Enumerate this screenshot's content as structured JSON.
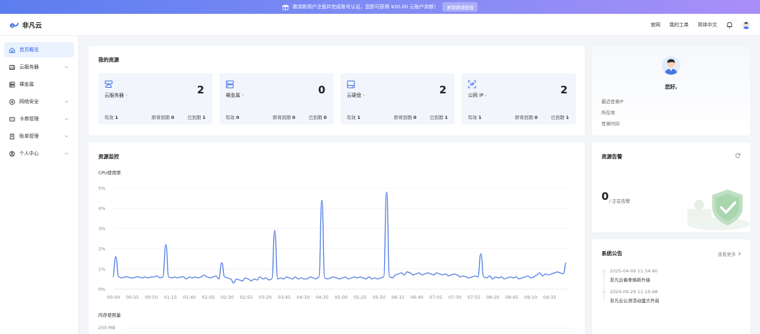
{
  "banner": {
    "text": "邀请新用户注册并完成账号认证，您即可获得 ¥20.00 元账户余额！",
    "button": "复制邀请链接"
  },
  "header": {
    "brand": "非凡云",
    "links": [
      "官网",
      "我的工单",
      "简体中文"
    ]
  },
  "sidebar": {
    "items": [
      {
        "label": "首页概览",
        "icon": "home-icon",
        "active": true
      },
      {
        "label": "云服务器",
        "icon": "image-icon",
        "chevron": true
      },
      {
        "label": "裸金属",
        "icon": "server-icon"
      },
      {
        "label": "网络安全",
        "icon": "shield-icon",
        "chevron": true
      },
      {
        "label": "卡券管理",
        "icon": "ticket-icon",
        "chevron": true
      },
      {
        "label": "账单管理",
        "icon": "bill-icon",
        "chevron": true
      },
      {
        "label": "个人中心",
        "icon": "user-circle-icon",
        "chevron": true
      }
    ]
  },
  "resources": {
    "title": "我的资源",
    "items": [
      {
        "name": "云服务器",
        "icon": "cloud-server-icon",
        "count": "2",
        "active_label": "有效",
        "active": "1",
        "expiring_label": "即将到期",
        "expiring": "0",
        "expired_label": "已到期",
        "expired": "1"
      },
      {
        "name": "裸金属",
        "icon": "bare-metal-icon",
        "count": "0",
        "active_label": "有效",
        "active": "0",
        "expiring_label": "即将到期",
        "expiring": "0",
        "expired_label": "已到期",
        "expired": "0"
      },
      {
        "name": "云硬盘",
        "icon": "disk-icon",
        "count": "2",
        "active_label": "有效",
        "active": "1",
        "expiring_label": "即将到期",
        "expiring": "0",
        "expired_label": "已到期",
        "expired": "1"
      },
      {
        "name": "公网 IP",
        "icon": "ip-icon",
        "count": "2",
        "active_label": "有效",
        "active": "1",
        "expiring_label": "即将到期",
        "expiring": "0",
        "expired_label": "已到期",
        "expired": "1"
      }
    ]
  },
  "profile": {
    "greeting": "您好,",
    "last_login_ip": "最近登录IP",
    "location": "所在地",
    "login_time": "登录时间"
  },
  "monitor": {
    "title": "资源监控",
    "cpu_label": "CPU使用率",
    "mem_label": "内存使用量",
    "mem_tick": "250 MB"
  },
  "alerts": {
    "title": "资源告警",
    "count": "0",
    "count_label": "/ 正在告警"
  },
  "notices": {
    "title": "系统公告",
    "more": "查看更多",
    "items": [
      {
        "time": "2025-04-09 11:34:40",
        "text": "非凡云春季焕新升级"
      },
      {
        "time": "2024-09-29 11:10:48",
        "text": "非凡云公测活动盛大开启"
      }
    ]
  },
  "colors": {
    "accent": "#3668e8",
    "line": "#4a78e0"
  },
  "chart_data": {
    "type": "line",
    "title": "CPU使用率",
    "ylim": [
      0,
      5
    ],
    "y_ticks": [
      "0%",
      "1%",
      "2%",
      "3%",
      "4%",
      "5%"
    ],
    "x_ticks": [
      "00:00",
      "00:25",
      "00:50",
      "01:15",
      "01:40",
      "02:05",
      "02:30",
      "02:55",
      "03:20",
      "03:45",
      "04:10",
      "04:35",
      "05:00",
      "05:25",
      "05:50",
      "06:15",
      "06:40",
      "07:05",
      "07:30",
      "07:55",
      "08:20",
      "08:45",
      "09:10",
      "09:35"
    ],
    "series": [
      {
        "values": [
          0.6,
          1.6,
          0.6,
          0.55,
          0.6,
          0.6,
          0.55,
          0.55,
          0.6,
          0.6,
          0.55,
          0.6,
          0.55,
          0.6,
          0.6,
          0.65,
          0.55,
          0.6,
          2.2,
          0.6,
          0.55,
          0.6,
          0.55,
          0.6,
          0.6,
          0.5,
          0.6,
          0.55,
          0.6,
          0.55,
          0.6,
          0.7,
          0.6,
          0.55,
          0.6,
          0.65,
          0.5,
          1.3,
          0.6,
          0.55,
          0.5,
          0.3,
          0.5,
          0.45,
          0.4,
          0.55,
          0.5,
          0.4,
          0.5,
          0.45,
          0.6,
          0.5,
          0.55,
          0.45,
          0.5,
          2.9,
          0.5,
          0.55,
          0.5,
          0.6,
          0.55,
          0.5,
          0.6,
          0.5,
          0.55,
          0.5,
          0.5,
          0.6,
          0.55,
          0.5,
          0.6,
          4.4,
          0.55,
          0.5,
          0.55,
          0.6,
          0.55,
          0.5,
          0.55,
          0.6,
          0.5,
          0.55,
          0.6,
          0.55,
          0.6,
          0.55,
          0.5,
          0.6,
          0.5,
          0.55,
          0.5,
          0.55,
          0.6,
          4.8,
          0.6,
          0.55,
          0.7,
          0.75,
          0.8,
          0.7,
          0.85,
          0.8,
          0.7,
          0.75,
          0.8,
          0.7,
          0.75,
          0.8,
          0.75,
          0.7,
          0.8,
          0.75,
          0.7,
          0.75,
          0.65,
          0.7,
          0.75,
          0.7,
          0.6,
          0.65,
          0.6,
          0.55,
          0.6,
          0.65,
          0.6,
          1.75,
          0.6,
          0.55,
          0.65,
          0.5,
          0.6,
          0.55,
          0.6,
          0.5,
          0.55,
          0.6,
          0.55,
          0.6,
          0.5,
          0.55,
          0.6,
          0.65,
          0.55,
          0.6,
          0.7,
          0.8,
          0.65,
          0.75,
          0.7,
          0.75,
          0.8,
          0.85,
          0.8,
          0.75,
          1.3
        ]
      }
    ]
  }
}
